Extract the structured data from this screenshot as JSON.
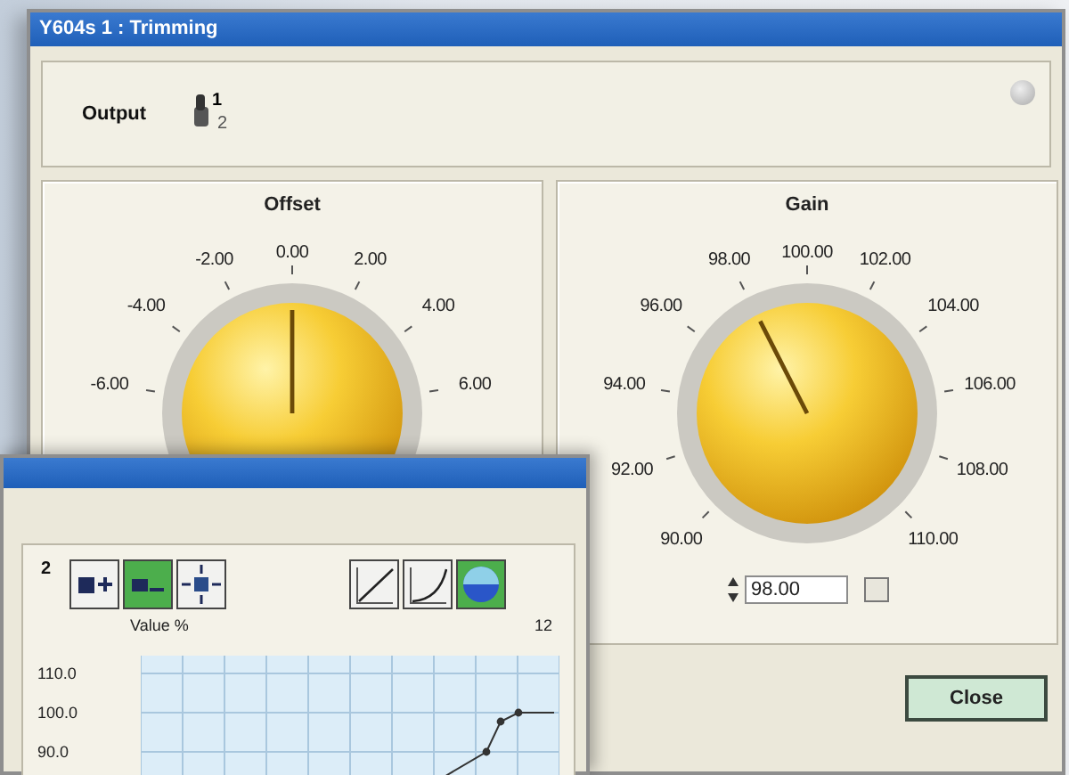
{
  "window": {
    "title": "Y604s 1 : Trimming"
  },
  "output": {
    "label": "Output",
    "positions": [
      {
        "label": "1",
        "selected": true
      },
      {
        "label": "2",
        "selected": false
      }
    ]
  },
  "knobs": [
    {
      "title": "Offset",
      "scale_labels": [
        "-6.00",
        "-4.00",
        "-2.00",
        "0.00",
        "2.00",
        "4.00",
        "6.00"
      ],
      "level": 0.5
    },
    {
      "title": "Gain",
      "scale_labels": [
        "90.00",
        "92.00",
        "94.00",
        "96.00",
        "98.00",
        "100.00",
        "102.00",
        "104.00",
        "106.00",
        "108.00",
        "110.00"
      ],
      "level": 0.4,
      "field_value": "98.00"
    }
  ],
  "close_button": "Close",
  "curve_window": {
    "point_label": "2",
    "point_tools": [
      {
        "kind": "add",
        "selected": false
      },
      {
        "kind": "remove",
        "selected": true
      },
      {
        "kind": "move",
        "selected": false
      }
    ],
    "curve_tools": [
      {
        "kind": "linear",
        "selected": false
      },
      {
        "kind": "curve",
        "selected": false
      },
      {
        "kind": "fill",
        "selected": true
      }
    ],
    "chart_title": "Value %",
    "corner_label": "12",
    "y_tick_labels": [
      "110.0",
      "100.0",
      "90.0"
    ]
  }
}
